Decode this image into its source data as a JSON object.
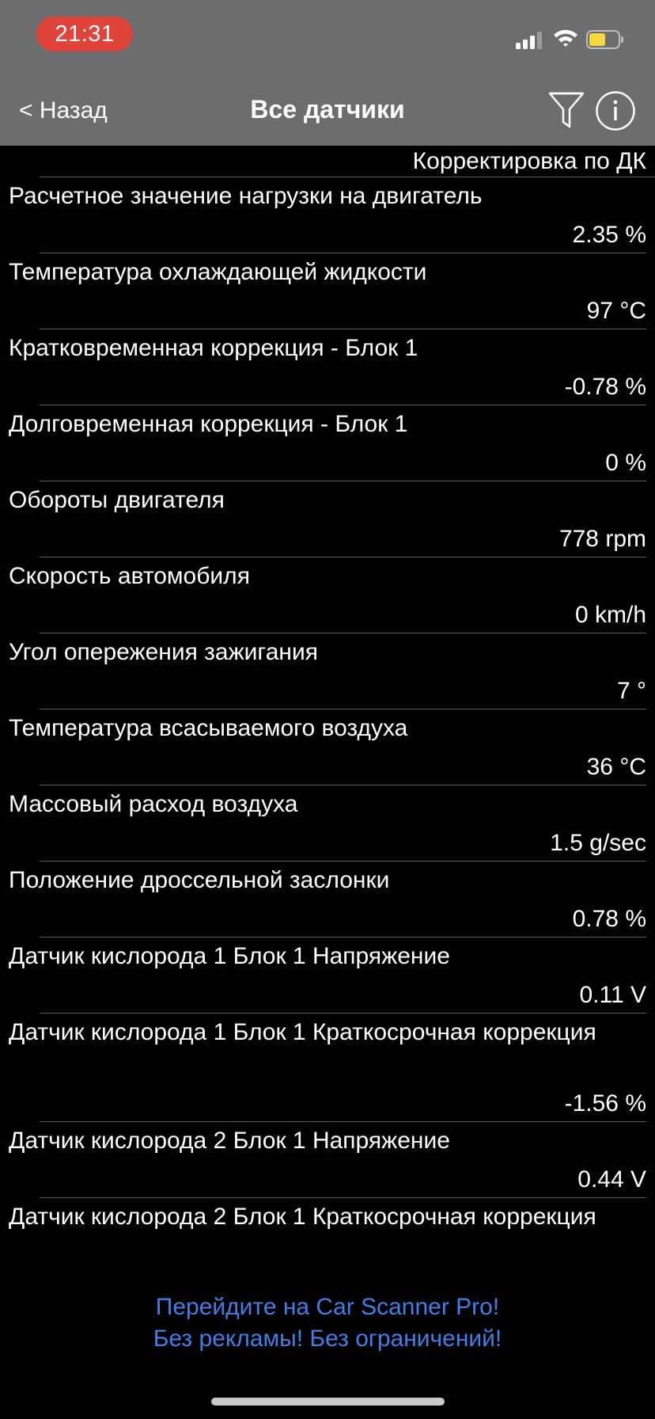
{
  "status_bar": {
    "time": "21:31",
    "icons": [
      "cellular-signal-icon",
      "wifi-icon",
      "battery-icon"
    ]
  },
  "nav": {
    "back_label": "< Назад",
    "title": "Все датчики",
    "filter_icon": "filter-funnel-icon",
    "info_icon": "info-icon"
  },
  "list": {
    "section_header": "Корректировка по ДК",
    "sensors": [
      {
        "name": "Расчетное значение нагрузки на двигатель",
        "value": "2.35 %"
      },
      {
        "name": "Температура охлаждающей жидкости",
        "value": "97 °C"
      },
      {
        "name": "Кратковременная коррекция - Блок 1",
        "value": "-0.78 %"
      },
      {
        "name": "Долговременная коррекция - Блок 1",
        "value": "0 %"
      },
      {
        "name": "Обороты двигателя",
        "value": "778 rpm"
      },
      {
        "name": "Скорость автомобиля",
        "value": "0 km/h"
      },
      {
        "name": "Угол опережения зажигания",
        "value": "7 °"
      },
      {
        "name": "Температура всасываемого воздуха",
        "value": "36 °C"
      },
      {
        "name": "Массовый расход воздуха",
        "value": "1.5 g/sec"
      },
      {
        "name": "Положение дроссельной заслонки",
        "value": "0.78 %"
      },
      {
        "name": "Датчик кислорода 1 Блок 1 Напряжение",
        "value": "0.11 V"
      },
      {
        "name": "Датчик кислорода 1 Блок 1 Краткосрочная коррекция",
        "value": "-1.56 %"
      },
      {
        "name": "Датчик кислорода 2 Блок 1 Напряжение",
        "value": "0.44 V"
      },
      {
        "name": "Датчик кислорода 2 Блок 1 Краткосрочная коррекция",
        "value": ""
      }
    ]
  },
  "promo": {
    "line1": "Перейдите на Car Scanner Pro!",
    "line2": "Без рекламы! Без ограничений!"
  },
  "colors": {
    "header_bg": "#6d6d6f",
    "time_pill": "#e0433a",
    "battery_fill": "#f5d742",
    "promo_link": "#3f7fe6",
    "background": "#000000"
  }
}
